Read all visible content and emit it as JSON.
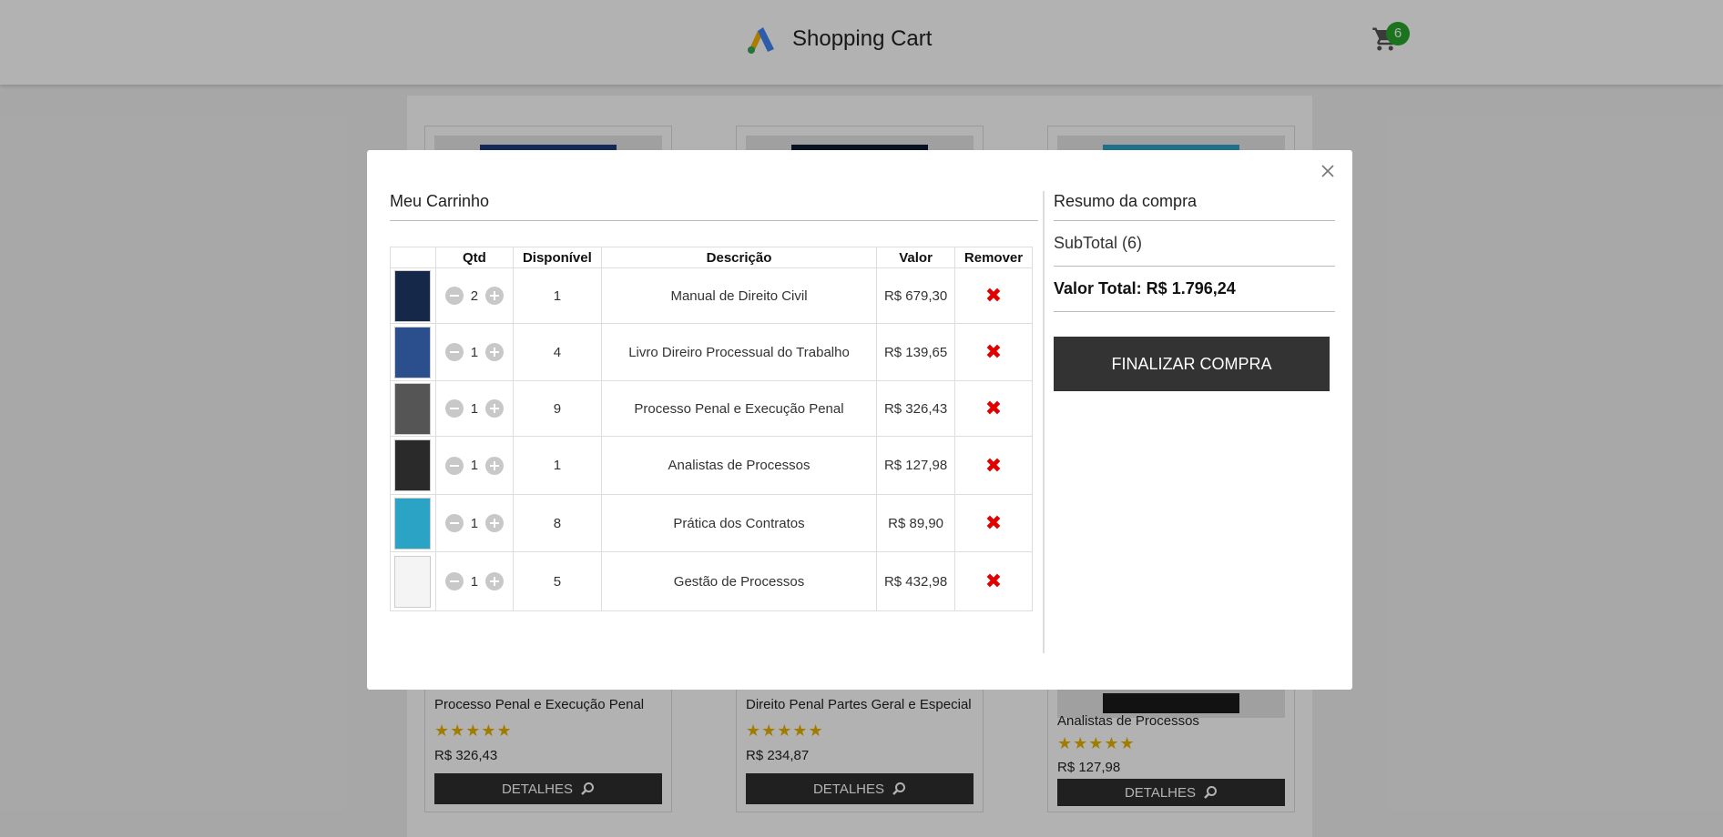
{
  "header": {
    "title": "Shopping Cart",
    "cart_count": "6"
  },
  "products": [
    {
      "name": "Processo Penal e Execução Penal",
      "stars": "★★★★★",
      "price": "R$ 326,43",
      "button": "DETALHES"
    },
    {
      "name": "Direito Penal Partes Geral e Especial",
      "stars": "★★★★★",
      "price": "R$ 234,87",
      "button": "DETALHES"
    },
    {
      "name": "Analistas de Processos",
      "stars": "★★★★★",
      "price": "R$ 127,98",
      "button": "DETALHES"
    }
  ],
  "modal": {
    "cart_title": "Meu Carrinho",
    "columns": [
      "",
      "Qtd",
      "Disponível",
      "Descrição",
      "Valor",
      "Remover"
    ],
    "items": [
      {
        "qty": "2",
        "available": "1",
        "description": "Manual de Direito Civil",
        "value": "R$ 679,30",
        "thumb_color": "#15284a"
      },
      {
        "qty": "1",
        "available": "4",
        "description": "Livro Direiro Processual do Trabalho",
        "value": "R$ 139,65",
        "thumb_color": "#2b4f8c"
      },
      {
        "qty": "1",
        "available": "9",
        "description": "Processo Penal e Execução Penal",
        "value": "R$ 326,43",
        "thumb_color": "#555555"
      },
      {
        "qty": "1",
        "available": "1",
        "description": "Analistas de Processos",
        "value": "R$ 127,98",
        "thumb_color": "#2a2a2a"
      },
      {
        "qty": "1",
        "available": "8",
        "description": "Prática dos Contratos",
        "value": "R$ 89,90",
        "thumb_color": "#2ba3c4"
      },
      {
        "qty": "1",
        "available": "5",
        "description": "Gestão de Processos",
        "value": "R$ 432,98",
        "thumb_color": "#f4f4f4"
      }
    ],
    "summary": {
      "title": "Resumo da compra",
      "subtotal": "SubTotal (6)",
      "total": "Valor Total: R$ 1.796,24",
      "finalize_label": "FINALIZAR COMPRA"
    }
  }
}
